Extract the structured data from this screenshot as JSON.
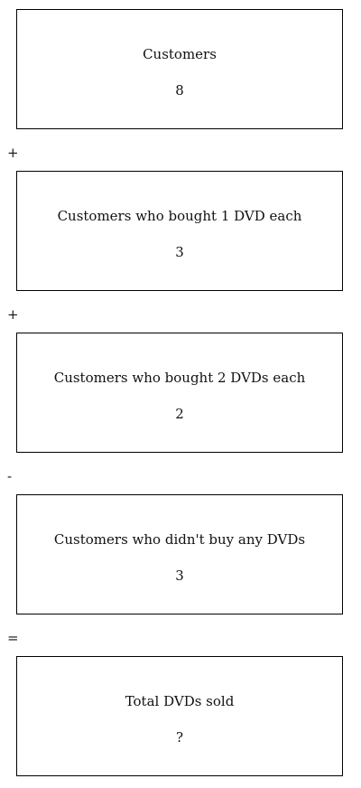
{
  "steps": [
    {
      "label": "Customers",
      "value": "8"
    },
    {
      "label": "Customers who bought 1 DVD each",
      "value": "3"
    },
    {
      "label": "Customers who bought 2 DVDs each",
      "value": "2"
    },
    {
      "label": "Customers who didn't buy any DVDs",
      "value": "3"
    },
    {
      "label": "Total DVDs sold",
      "value": "?"
    }
  ],
  "operators": [
    "+",
    "+",
    "-",
    "="
  ]
}
